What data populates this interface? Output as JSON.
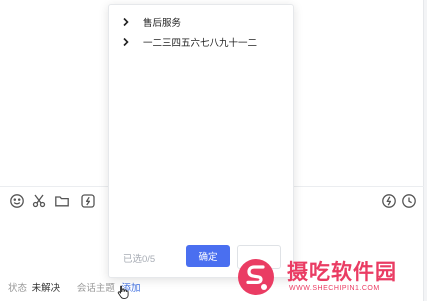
{
  "dropdown": {
    "items": [
      {
        "label": "售后服务",
        "icon": "chevron-right-icon"
      },
      {
        "label": "一二三四五六七八九十一二",
        "icon": "chevron-right-icon"
      }
    ],
    "selected_count": "已选0/5",
    "confirm_label": "确定"
  },
  "toolbar": {
    "icons": [
      "emoji-icon",
      "scissors-icon",
      "folder-icon",
      "quick-reply-icon",
      "lightning-icon",
      "clock-icon"
    ]
  },
  "status": {
    "state_label": "状态",
    "state_value": "未解决",
    "topic_label": "会话主题",
    "topic_add": "添加"
  },
  "watermark": {
    "title": "摄吃软件园",
    "url": "WWW.SHECHIPIN1.COM"
  },
  "colors": {
    "primary": "#4a6ff0",
    "link": "#3f6fe0",
    "watermark": "#ea3c63"
  }
}
